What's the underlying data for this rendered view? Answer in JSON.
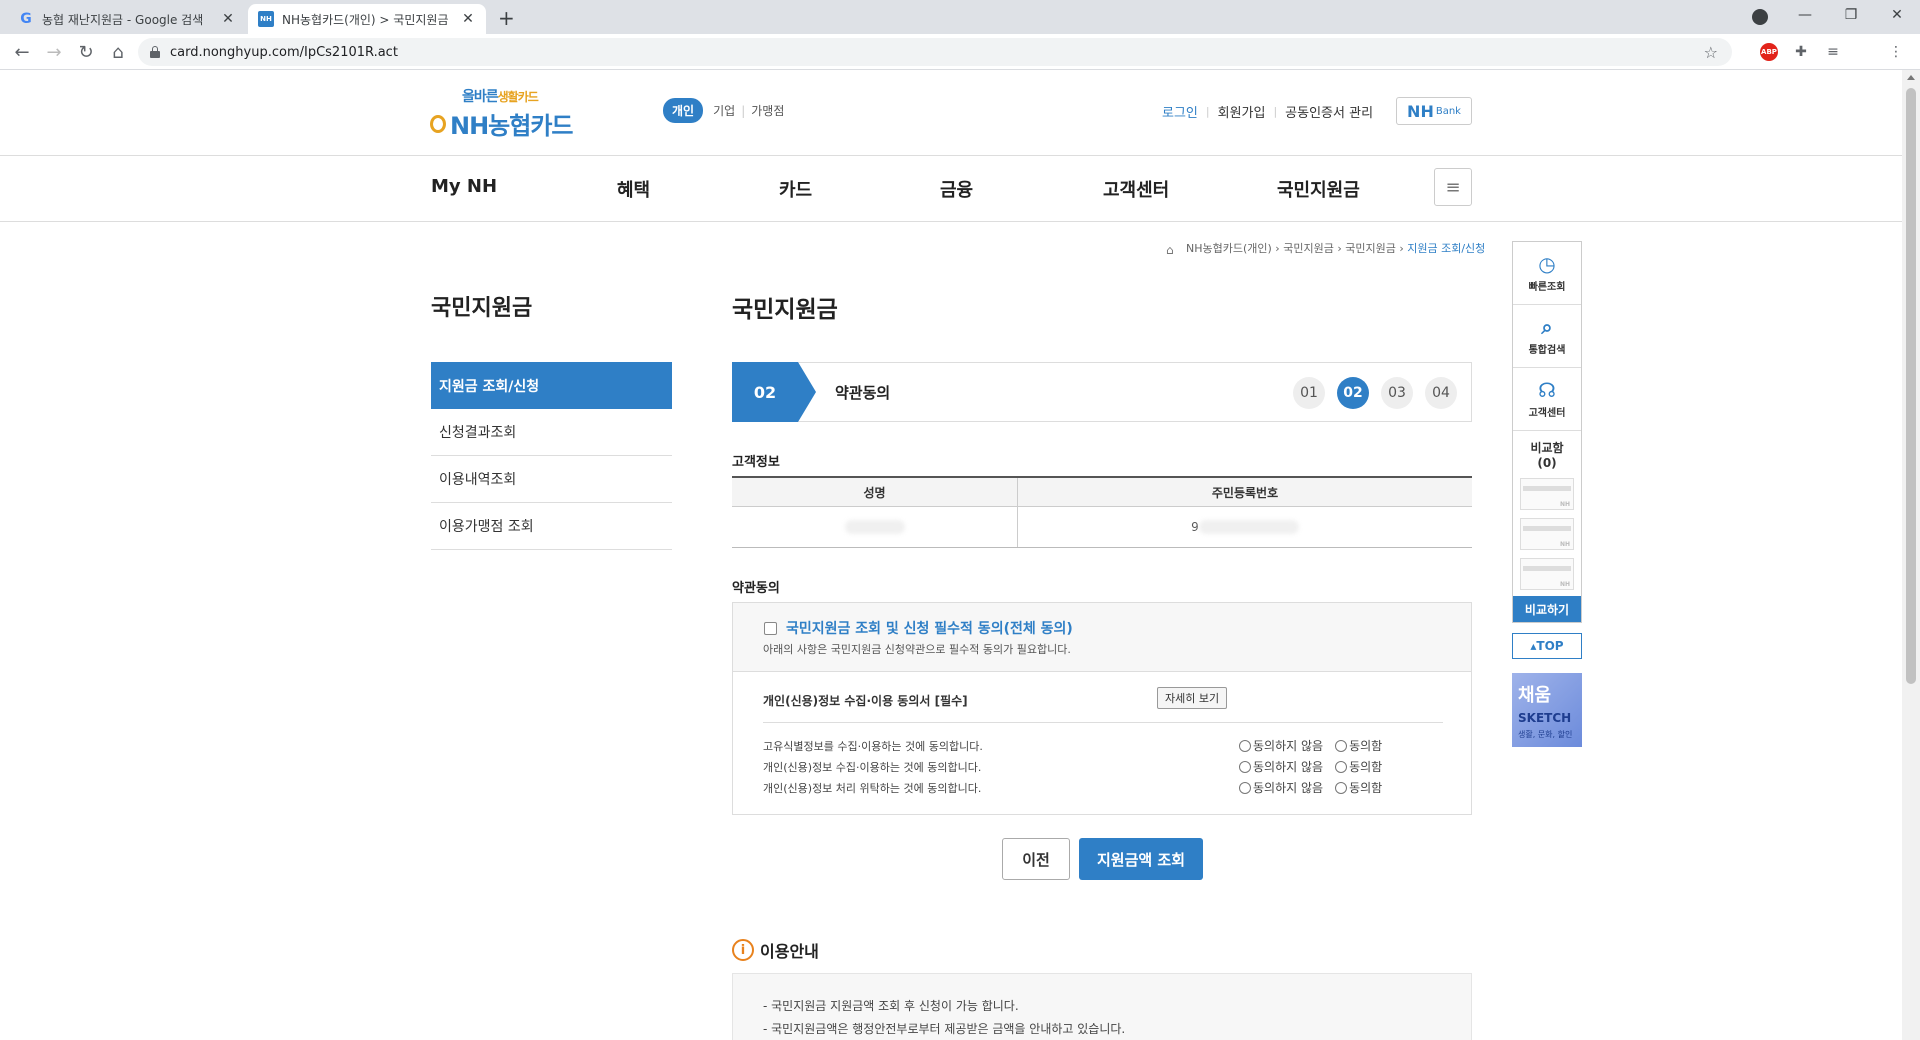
{
  "browser": {
    "tabs": [
      {
        "title": "농협 재난지원금 - Google 검색",
        "favicon": "G"
      },
      {
        "title": "NH농협카드(개인) > 국민지원금",
        "favicon": "NH"
      }
    ],
    "url": "card.nonghyup.com/IpCs2101R.act",
    "abp_label": "ABP"
  },
  "header": {
    "logo_slogan_a": "올바른",
    "logo_slogan_b": "생활카드",
    "logo_brand": "NH농협카드",
    "segments": [
      "개인",
      "기업",
      "가맹점"
    ],
    "util": [
      "로그인",
      "회원가입",
      "공동인증서 관리"
    ],
    "nhbank_a": "NH",
    "nhbank_b": "Bank"
  },
  "gnb": [
    "My NH",
    "혜택",
    "카드",
    "금융",
    "고객센터",
    "국민지원금"
  ],
  "breadcrumb": [
    "NH농협카드(개인)",
    "국민지원금",
    "국민지원금",
    "지원금 조회/신청"
  ],
  "lnb": {
    "title": "국민지원금",
    "items": [
      "지원금 조회/신청",
      "신청결과조회",
      "이용내역조회",
      "이용가맹점 조회"
    ]
  },
  "content": {
    "title": "국민지원금",
    "step": {
      "number": "02",
      "label": "약관동의",
      "steps": [
        "01",
        "02",
        "03",
        "04"
      ],
      "current": "02"
    },
    "customer": {
      "section": "고객정보",
      "headers": [
        "성명",
        "주민등록번호"
      ],
      "rrn_prefix": "9"
    },
    "agreement": {
      "section": "약관동의",
      "all_title": "국민지원금 조회 및 신청 필수적 동의(전체 동의)",
      "all_desc": "아래의 사항은 국민지원금 신청약관으로 필수적 동의가 필요합니다.",
      "detail_title": "개인(신용)정보 수집·이용 동의서 [필수]",
      "detail_button": "자세히 보기",
      "questions": [
        "고유식별정보를 수집·이용하는 것에 동의합니다.",
        "개인(신용)정보 수집·이용하는 것에 동의합니다.",
        "개인(신용)정보 처리 위탁하는 것에 동의합니다."
      ],
      "option_no": "동의하지 않음",
      "option_yes": "동의함"
    },
    "buttons": {
      "prev": "이전",
      "submit": "지원금액 조회"
    },
    "guide": {
      "title": "이용안내",
      "lines": [
        "- 국민지원금 지원금액 조회 후 신청이 가능 합니다.",
        "- 국민지원금액은 행정안전부로부터 제공받은 금액을 안내하고 있습니다."
      ]
    }
  },
  "quick": {
    "items": [
      "빠른조회",
      "통합검색",
      "고객센터"
    ],
    "compare": "비교함 (0)",
    "slot_mark": "NH",
    "compare_button": "비교하기",
    "top": "TOP",
    "banner_a": "채움",
    "banner_b": "SKETCH",
    "banner_c": "생활, 문화, 할인"
  }
}
